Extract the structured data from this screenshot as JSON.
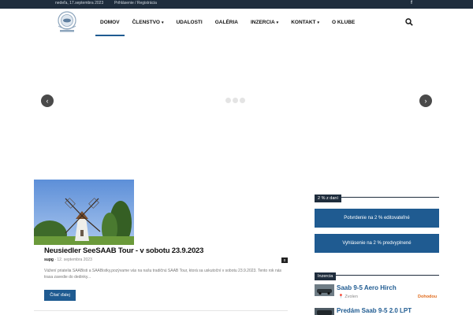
{
  "topbar": {
    "date": "nedeľa, 17.septembra 2023",
    "login": "Prihlásenie / Registrácia",
    "facebook_icon": "f"
  },
  "logo": {
    "alt": "SAAB klub logo",
    "text": "SLOVAKIA"
  },
  "nav": {
    "items": [
      {
        "label": "DOMOV",
        "caret": ""
      },
      {
        "label": "ČLENSTVO",
        "caret": "▾"
      },
      {
        "label": "UDALOSTI",
        "caret": ""
      },
      {
        "label": "GALÉRIA",
        "caret": ""
      },
      {
        "label": "INZERCIA",
        "caret": "▾"
      },
      {
        "label": "KONTAKT",
        "caret": "▾"
      },
      {
        "label": "O KLUBE",
        "caret": ""
      }
    ]
  },
  "slider": {
    "prev": "‹",
    "next": "›"
  },
  "post": {
    "title": "Neusiedler SeeSAAB Tour - v sobotu 23.9.2023",
    "author": "supg",
    "date": "- 12. septembra 2023",
    "comments": "0",
    "excerpt": "Vážení priatelia SAABisti a SAABistky,pozývame vás na našu tradičnú SAAB Tour, ktorá sa uskutoční v sobotu 23.9.2023. Tento rok nás trasa zavedie do dedinky...",
    "read_more": "Čítať ďalej"
  },
  "sidebar": {
    "tax_title": "2 % z daní",
    "btn_editable": "Potvrdenie na 2 % editovateľné",
    "btn_prefilled": "Vyhlásenie na 2 % predvyplnené",
    "ads_title": "Inzercia",
    "ads": [
      {
        "title": "Saab 9-5 Aero Hirch",
        "location": "Zvolen",
        "price": "Dohodou"
      },
      {
        "title": "Predám Saab 9-5 2.0 LPT",
        "location": "",
        "price": ""
      }
    ]
  },
  "colors": {
    "accent": "#1f5b91",
    "topbar": "#1f2d3d",
    "price": "#e06b1c"
  }
}
